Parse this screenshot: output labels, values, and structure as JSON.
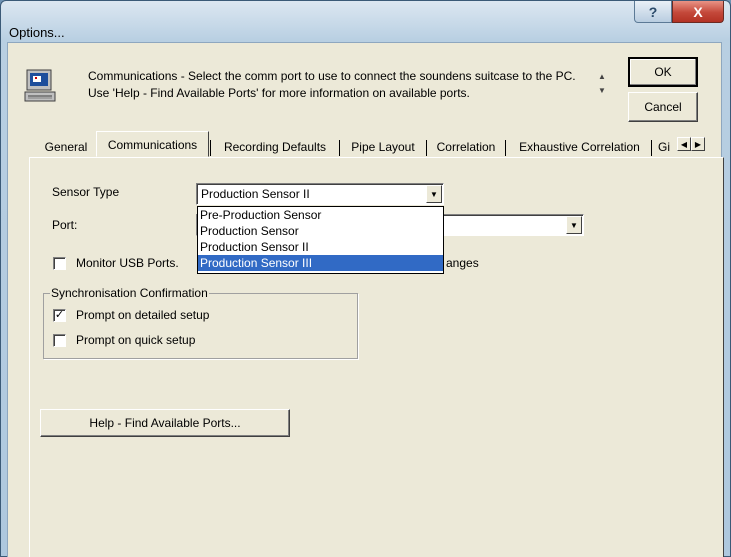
{
  "window": {
    "title": "Options...",
    "help_glyph": "?",
    "close_glyph": "X"
  },
  "description": {
    "text": "Communications - Select the comm port to use to connect the soundens suitcase to the PC. Use 'Help - Find Available Ports' for more information on available ports.",
    "scroll_up": "▲",
    "scroll_down": "▼"
  },
  "buttons": {
    "ok": "OK",
    "cancel": "Cancel",
    "help_ports": "Help - Find Available Ports..."
  },
  "tabs": [
    {
      "label": "General"
    },
    {
      "label": "Communications"
    },
    {
      "label": "Recording Defaults"
    },
    {
      "label": "Pipe Layout"
    },
    {
      "label": "Correlation"
    },
    {
      "label": "Exhaustive Correlation"
    },
    {
      "label": "Gi"
    }
  ],
  "tab_arrows": {
    "left": "◀",
    "right": "▶"
  },
  "sensor": {
    "label": "Sensor Type",
    "value": "Production Sensor II",
    "options": [
      {
        "label": "Pre-Production Sensor",
        "selected": false
      },
      {
        "label": "Production Sensor",
        "selected": false
      },
      {
        "label": "Production Sensor II",
        "selected": false
      },
      {
        "label": "Production Sensor III",
        "selected": true
      }
    ]
  },
  "port": {
    "label": "Port:",
    "value": ""
  },
  "monitor_usb": {
    "label_left": "Monitor USB Ports.",
    "label_right": "anges",
    "checked": false
  },
  "sync": {
    "label": "Synchronisation Confirmation",
    "detailed": {
      "label": "Prompt on detailed setup",
      "checked": true,
      "mark": "✓"
    },
    "quick": {
      "label": "Prompt on quick setup",
      "checked": false
    }
  },
  "colors": {
    "selection": "#316ac5",
    "dialog_bg": "#ece9d8",
    "close_button": "#c4483a"
  },
  "icons": {
    "app": "computer-icon",
    "dropdown": "chevron-down-icon"
  }
}
